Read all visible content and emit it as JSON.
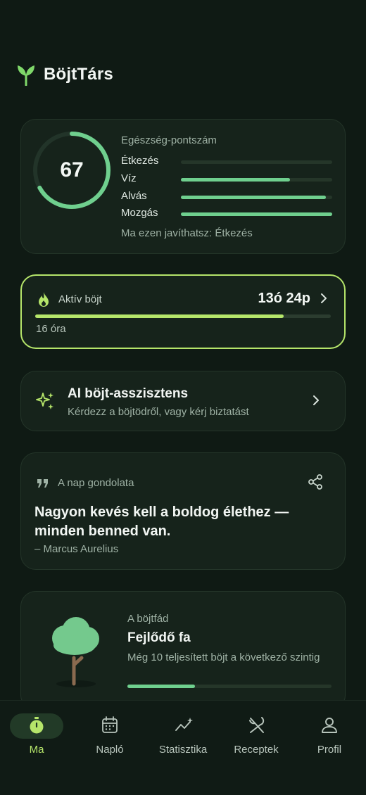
{
  "app": {
    "title": "BöjtTárs"
  },
  "health": {
    "title": "Egészség-pontszám",
    "score": "67",
    "score_fraction": 0.67,
    "metrics": [
      {
        "label": "Étkezés",
        "value": 0.0
      },
      {
        "label": "Víz",
        "value": 0.72
      },
      {
        "label": "Alvás",
        "value": 0.96
      },
      {
        "label": "Mozgás",
        "value": 1.0
      }
    ],
    "tip": "Ma ezen javíthatsz: Étkezés"
  },
  "active_fast": {
    "label": "Aktív böjt",
    "elapsed": "13ó 24p",
    "goal": "16 óra",
    "progress": 0.84
  },
  "assistant": {
    "title": "AI böjt-asszisztens",
    "subtitle": "Kérdezz a böjtödről, vagy kérj biztatást"
  },
  "quote": {
    "label": "A nap gondolata",
    "text": "Nagyon kevés kell a boldog élethez — minden benned van.",
    "author": "– Marcus Aurelius"
  },
  "tree": {
    "label": "A böjtfád",
    "title": "Fejlődő fa",
    "description": "Még 10 teljesített böjt a következő szintig",
    "progress": 0.33
  },
  "nav": {
    "items": [
      {
        "label": "Ma",
        "icon": "timer-icon",
        "active": true
      },
      {
        "label": "Napló",
        "icon": "calendar-icon",
        "active": false
      },
      {
        "label": "Statisztika",
        "icon": "chart-sparkle-icon",
        "active": false
      },
      {
        "label": "Receptek",
        "icon": "fork-knife-icon",
        "active": false
      },
      {
        "label": "Profil",
        "icon": "person-icon",
        "active": false
      }
    ]
  },
  "colors": {
    "accent": "#b5e56a",
    "green": "#6fcf8e",
    "background": "#0f1a14",
    "card": "#16231b"
  }
}
